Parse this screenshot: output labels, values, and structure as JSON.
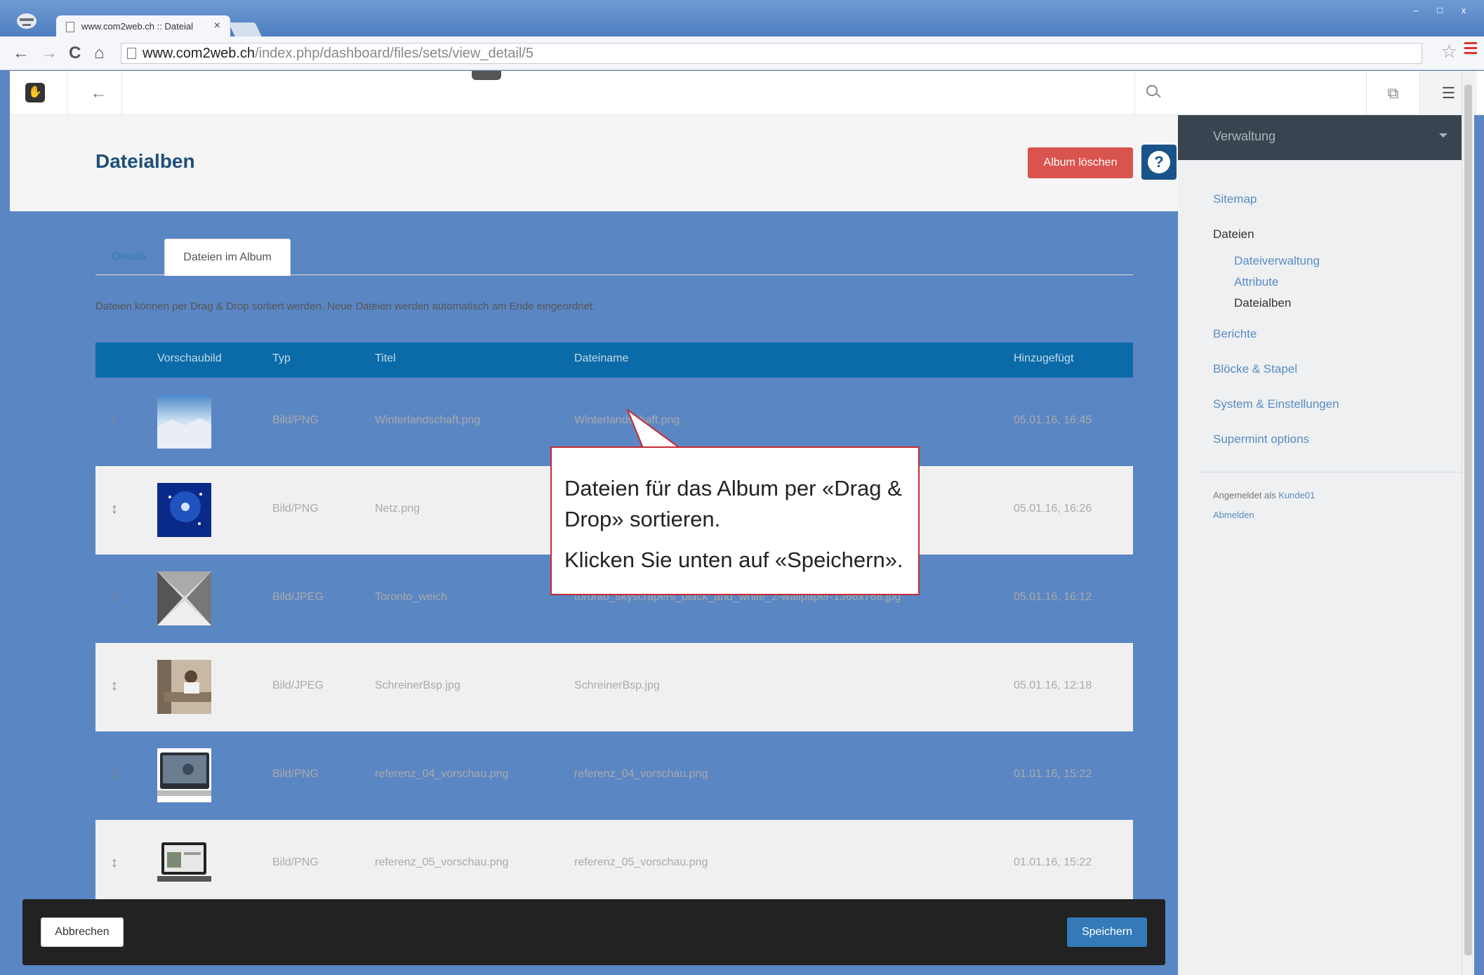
{
  "browser": {
    "tab_title": "www.com2web.ch :: Dateial",
    "url_host": "www.com2web.ch",
    "url_path": "/index.php/dashboard/files/sets/view_detail/5"
  },
  "header": {
    "title": "Dateialben",
    "delete_label": "Album löschen",
    "help_glyph": "?"
  },
  "tabs": [
    {
      "label": "Details"
    },
    {
      "label": "Dateien im Album"
    }
  ],
  "hint": "Dateien können per Drag & Drop sortiert werden. Neue Dateien werden automatisch am Ende eingeordnet.",
  "table": {
    "columns": [
      "Vorschaubild",
      "Typ",
      "Titel",
      "Dateiname",
      "Hinzugefügt"
    ],
    "rows": [
      {
        "type": "Bild/PNG",
        "title": "Winterlandschaft.png",
        "filename": "Winterlandschaft.png",
        "added": "05.01.16, 16:45"
      },
      {
        "type": "Bild/PNG",
        "title": "Netz.png",
        "filename": "",
        "added": "05.01.16, 16:26"
      },
      {
        "type": "Bild/JPEG",
        "title": "Toronto_weich",
        "filename": "toronto_skyscrapers_black_and_white_2-wallpaper-1366x768.jpg",
        "added": "05.01.16, 16:12"
      },
      {
        "type": "Bild/JPEG",
        "title": "SchreinerBsp.jpg",
        "filename": "SchreinerBsp.jpg",
        "added": "05.01.16, 12:18"
      },
      {
        "type": "Bild/PNG",
        "title": "referenz_04_vorschau.png",
        "filename": "referenz_04_vorschau.png",
        "added": "01.01.16, 15:22"
      },
      {
        "type": "Bild/PNG",
        "title": "referenz_05_vorschau.png",
        "filename": "referenz_05_vorschau.png",
        "added": "01.01.16, 15:22"
      }
    ]
  },
  "callout": {
    "line1": "Dateien für das Album per «Drag & Drop» sortieren.",
    "line2": "Klicken Sie unten auf «Speichern»."
  },
  "sidebar": {
    "title": "Verwaltung",
    "sitemap": "Sitemap",
    "files": "Dateien",
    "file_manager": "Dateiverwaltung",
    "attributes": "Attribute",
    "file_sets": "Dateialben",
    "reports": "Berichte",
    "blocks": "Blöcke & Stapel",
    "system": "System & Einstellungen",
    "supermint": "Supermint options",
    "logged_in_as": "Angemeldet als",
    "user": "Kunde01",
    "logout": "Abmelden"
  },
  "footer": {
    "cancel_label": "Abbrechen",
    "save_label": "Speichern"
  },
  "colors": {
    "primary": "#0b6ba8",
    "danger": "#d9534f",
    "title": "#1d4f7a",
    "callout_border": "#c62c30"
  }
}
